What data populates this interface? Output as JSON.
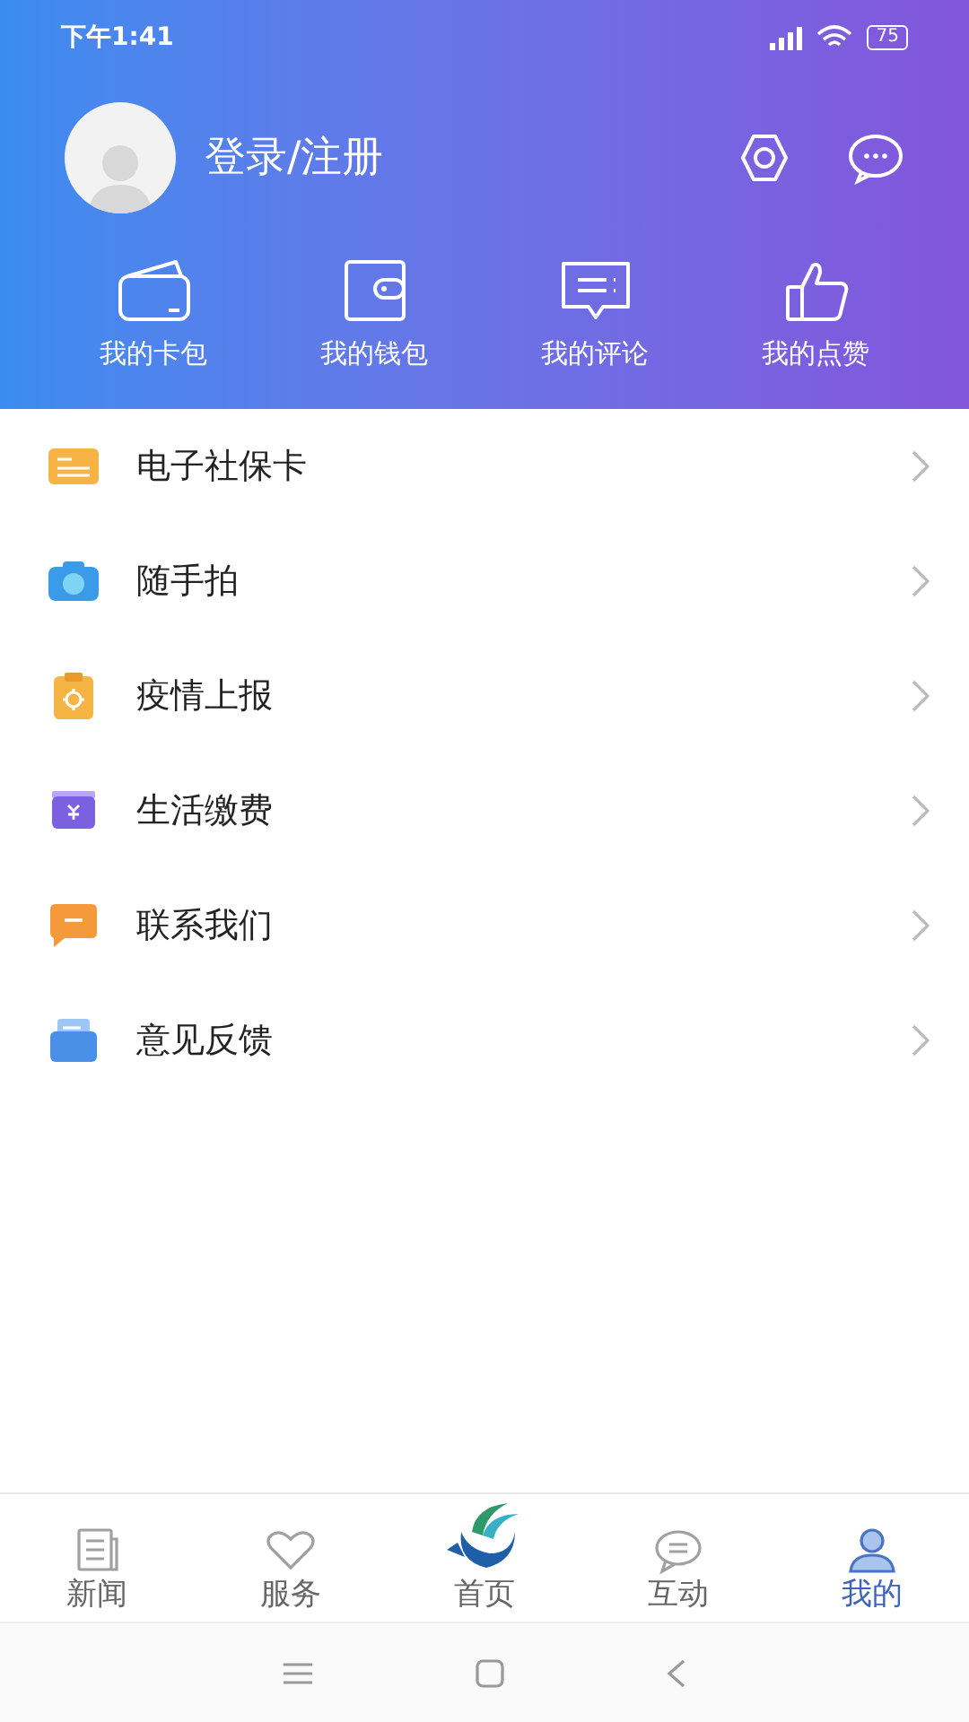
{
  "status_bar": {
    "time": "下午1:41",
    "battery": "75"
  },
  "profile": {
    "login_label": "登录/注册"
  },
  "quick_actions": [
    {
      "label": "我的卡包"
    },
    {
      "label": "我的钱包"
    },
    {
      "label": "我的评论"
    },
    {
      "label": "我的点赞"
    }
  ],
  "menu": [
    {
      "label": "电子社保卡"
    },
    {
      "label": "随手拍"
    },
    {
      "label": "疫情上报"
    },
    {
      "label": "生活缴费"
    },
    {
      "label": "联系我们"
    },
    {
      "label": "意见反馈"
    }
  ],
  "tab_bar": [
    {
      "label": "新闻",
      "selected": false
    },
    {
      "label": "服务",
      "selected": false
    },
    {
      "label": "首页",
      "selected": false
    },
    {
      "label": "互动",
      "selected": false
    },
    {
      "label": "我的",
      "selected": true
    }
  ]
}
